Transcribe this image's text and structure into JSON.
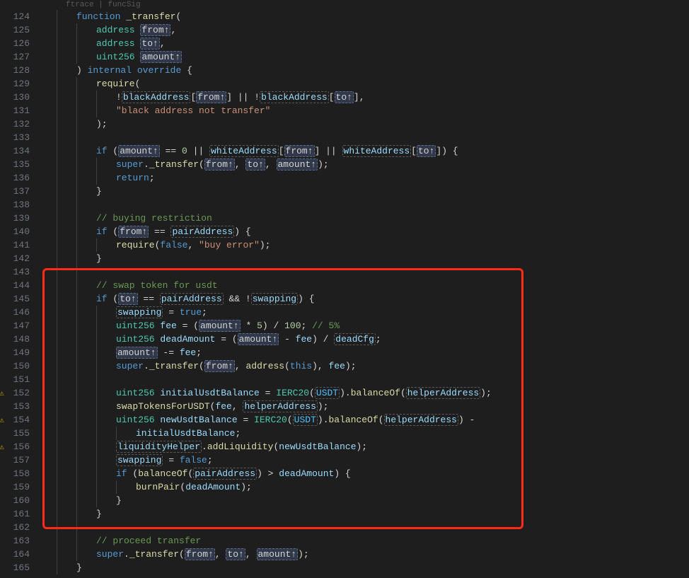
{
  "hint": "ftrace | funcSig",
  "lines": [
    {
      "n": 124,
      "indent": 1,
      "warn": false,
      "tokens": [
        [
          "kw",
          "function"
        ],
        [
          "sp",
          " "
        ],
        [
          "fn",
          "_transfer"
        ],
        [
          "pun",
          "("
        ]
      ]
    },
    {
      "n": 125,
      "indent": 2,
      "warn": false,
      "tokens": [
        [
          "ty",
          "address"
        ],
        [
          "sp",
          " "
        ],
        [
          "hl-param",
          "from↑"
        ],
        [
          "pun",
          ","
        ]
      ]
    },
    {
      "n": 126,
      "indent": 2,
      "warn": false,
      "tokens": [
        [
          "ty",
          "address"
        ],
        [
          "sp",
          " "
        ],
        [
          "hl-param",
          "to↑"
        ],
        [
          "pun",
          ","
        ]
      ]
    },
    {
      "n": 127,
      "indent": 2,
      "warn": false,
      "tokens": [
        [
          "ty",
          "uint256"
        ],
        [
          "sp",
          " "
        ],
        [
          "hl-param",
          "amount↑"
        ]
      ]
    },
    {
      "n": 128,
      "indent": 1,
      "warn": false,
      "tokens": [
        [
          "pun",
          ") "
        ],
        [
          "kw",
          "internal"
        ],
        [
          "sp",
          " "
        ],
        [
          "kw",
          "override"
        ],
        [
          "pun",
          " {"
        ]
      ]
    },
    {
      "n": 129,
      "indent": 2,
      "warn": false,
      "tokens": [
        [
          "fn",
          "require"
        ],
        [
          "pun",
          "("
        ]
      ]
    },
    {
      "n": 130,
      "indent": 3,
      "warn": false,
      "tokens": [
        [
          "op",
          "!"
        ],
        [
          "box var",
          "blackAddress"
        ],
        [
          "pun",
          "["
        ],
        [
          "hl-param",
          "from↑"
        ],
        [
          "pun",
          "] || !"
        ],
        [
          "box var",
          "blackAddress"
        ],
        [
          "pun",
          "["
        ],
        [
          "hl-param",
          "to↑"
        ],
        [
          "pun",
          "],"
        ]
      ]
    },
    {
      "n": 131,
      "indent": 3,
      "warn": false,
      "tokens": [
        [
          "str",
          "\"black address not transfer\""
        ]
      ]
    },
    {
      "n": 132,
      "indent": 2,
      "warn": false,
      "tokens": [
        [
          "pun",
          ");"
        ]
      ]
    },
    {
      "n": 133,
      "indent": 2,
      "warn": false,
      "tokens": []
    },
    {
      "n": 134,
      "indent": 2,
      "warn": false,
      "tokens": [
        [
          "kw",
          "if"
        ],
        [
          "pun",
          " ("
        ],
        [
          "hl-param",
          "amount↑"
        ],
        [
          "op",
          " == "
        ],
        [
          "num",
          "0"
        ],
        [
          "op",
          " || "
        ],
        [
          "box var",
          "whiteAddress"
        ],
        [
          "pun",
          "["
        ],
        [
          "hl-param",
          "from↑"
        ],
        [
          "pun",
          "] || "
        ],
        [
          "box var",
          "whiteAddress"
        ],
        [
          "pun",
          "["
        ],
        [
          "hl-param",
          "to↑"
        ],
        [
          "pun",
          "]) {"
        ]
      ]
    },
    {
      "n": 135,
      "indent": 3,
      "warn": false,
      "tokens": [
        [
          "kw",
          "super"
        ],
        [
          "pun",
          "."
        ],
        [
          "fn",
          "_transfer"
        ],
        [
          "pun",
          "("
        ],
        [
          "hl-param",
          "from↑"
        ],
        [
          "pun",
          ", "
        ],
        [
          "hl-param",
          "to↑"
        ],
        [
          "pun",
          ", "
        ],
        [
          "hl-param",
          "amount↑"
        ],
        [
          "pun",
          ");"
        ]
      ]
    },
    {
      "n": 136,
      "indent": 3,
      "warn": false,
      "tokens": [
        [
          "kw",
          "return"
        ],
        [
          "pun",
          ";"
        ]
      ]
    },
    {
      "n": 137,
      "indent": 2,
      "warn": false,
      "tokens": [
        [
          "pun",
          "}"
        ]
      ]
    },
    {
      "n": 138,
      "indent": 2,
      "warn": false,
      "tokens": []
    },
    {
      "n": 139,
      "indent": 2,
      "warn": false,
      "tokens": [
        [
          "cm",
          "// buying restriction"
        ]
      ]
    },
    {
      "n": 140,
      "indent": 2,
      "warn": false,
      "tokens": [
        [
          "kw",
          "if"
        ],
        [
          "pun",
          " ("
        ],
        [
          "hl-param",
          "from↑"
        ],
        [
          "op",
          " == "
        ],
        [
          "box var",
          "pairAddress"
        ],
        [
          "pun",
          ") {"
        ]
      ]
    },
    {
      "n": 141,
      "indent": 3,
      "warn": false,
      "tokens": [
        [
          "fn",
          "require"
        ],
        [
          "pun",
          "("
        ],
        [
          "kw",
          "false"
        ],
        [
          "pun",
          ", "
        ],
        [
          "str",
          "\"buy error\""
        ],
        [
          "pun",
          ");"
        ]
      ]
    },
    {
      "n": 142,
      "indent": 2,
      "warn": false,
      "tokens": [
        [
          "pun",
          "}"
        ]
      ]
    },
    {
      "n": 143,
      "indent": 2,
      "warn": false,
      "tokens": []
    },
    {
      "n": 144,
      "indent": 2,
      "warn": false,
      "tokens": [
        [
          "cm",
          "// swap token for usdt"
        ]
      ]
    },
    {
      "n": 145,
      "indent": 2,
      "warn": false,
      "tokens": [
        [
          "kw",
          "if"
        ],
        [
          "pun",
          " ("
        ],
        [
          "hl-param",
          "to↑"
        ],
        [
          "op",
          " == "
        ],
        [
          "box var",
          "pairAddress"
        ],
        [
          "op",
          " && !"
        ],
        [
          "box var",
          "swapping"
        ],
        [
          "pun",
          ") {"
        ]
      ]
    },
    {
      "n": 146,
      "indent": 3,
      "warn": false,
      "tokens": [
        [
          "box var",
          "swapping"
        ],
        [
          "op",
          " = "
        ],
        [
          "kw",
          "true"
        ],
        [
          "pun",
          ";"
        ]
      ]
    },
    {
      "n": 147,
      "indent": 3,
      "warn": false,
      "tokens": [
        [
          "ty",
          "uint256"
        ],
        [
          "sp",
          " "
        ],
        [
          "var",
          "fee"
        ],
        [
          "op",
          " = ("
        ],
        [
          "hl-param",
          "amount↑"
        ],
        [
          "op",
          " * "
        ],
        [
          "num",
          "5"
        ],
        [
          "pun",
          ") / "
        ],
        [
          "num",
          "100"
        ],
        [
          "pun",
          "; "
        ],
        [
          "cm",
          "// 5%"
        ]
      ]
    },
    {
      "n": 148,
      "indent": 3,
      "warn": false,
      "tokens": [
        [
          "ty",
          "uint256"
        ],
        [
          "sp",
          " "
        ],
        [
          "var",
          "deadAmount"
        ],
        [
          "op",
          " = ("
        ],
        [
          "hl-param",
          "amount↑"
        ],
        [
          "op",
          " - "
        ],
        [
          "var",
          "fee"
        ],
        [
          "pun",
          ") / "
        ],
        [
          "box var",
          "deadCfg"
        ],
        [
          "pun",
          ";"
        ]
      ]
    },
    {
      "n": 149,
      "indent": 3,
      "warn": false,
      "tokens": [
        [
          "hl-param",
          "amount↑"
        ],
        [
          "op",
          " -= "
        ],
        [
          "var",
          "fee"
        ],
        [
          "pun",
          ";"
        ]
      ]
    },
    {
      "n": 150,
      "indent": 3,
      "warn": false,
      "tokens": [
        [
          "kw",
          "super"
        ],
        [
          "pun",
          "."
        ],
        [
          "fn",
          "_transfer"
        ],
        [
          "pun",
          "("
        ],
        [
          "hl-param",
          "from↑"
        ],
        [
          "pun",
          ", "
        ],
        [
          "fn",
          "address"
        ],
        [
          "pun",
          "("
        ],
        [
          "kw",
          "this"
        ],
        [
          "pun",
          "), "
        ],
        [
          "var",
          "fee"
        ],
        [
          "pun",
          ");"
        ]
      ]
    },
    {
      "n": 151,
      "indent": 3,
      "warn": false,
      "tokens": []
    },
    {
      "n": 152,
      "indent": 3,
      "warn": true,
      "tokens": [
        [
          "ty",
          "uint256"
        ],
        [
          "sp",
          " "
        ],
        [
          "var",
          "initialUsdtBalance"
        ],
        [
          "op",
          " = "
        ],
        [
          "ty",
          "IERC20"
        ],
        [
          "pun",
          "("
        ],
        [
          "box const",
          "USDT"
        ],
        [
          "pun",
          ")."
        ],
        [
          "fn",
          "balanceOf"
        ],
        [
          "pun",
          "("
        ],
        [
          "box var",
          "helperAddress"
        ],
        [
          "pun",
          ");"
        ]
      ]
    },
    {
      "n": 153,
      "indent": 3,
      "warn": false,
      "tokens": [
        [
          "fn",
          "swapTokensForUSDT"
        ],
        [
          "pun",
          "("
        ],
        [
          "var",
          "fee"
        ],
        [
          "pun",
          ", "
        ],
        [
          "box var",
          "helperAddress"
        ],
        [
          "pun",
          ");"
        ]
      ]
    },
    {
      "n": 154,
      "indent": 3,
      "warn": true,
      "tokens": [
        [
          "ty",
          "uint256"
        ],
        [
          "sp",
          " "
        ],
        [
          "var",
          "newUsdtBalance"
        ],
        [
          "op",
          " = "
        ],
        [
          "ty",
          "IERC20"
        ],
        [
          "pun",
          "("
        ],
        [
          "box const",
          "USDT"
        ],
        [
          "pun",
          ")."
        ],
        [
          "fn",
          "balanceOf"
        ],
        [
          "pun",
          "("
        ],
        [
          "box var",
          "helperAddress"
        ],
        [
          "pun",
          ") -"
        ]
      ]
    },
    {
      "n": 155,
      "indent": 4,
      "warn": false,
      "tokens": [
        [
          "var",
          "initialUsdtBalance"
        ],
        [
          "pun",
          ";"
        ]
      ]
    },
    {
      "n": 156,
      "indent": 3,
      "warn": true,
      "tokens": [
        [
          "box var",
          "liquidityHelper"
        ],
        [
          "pun",
          "."
        ],
        [
          "fn",
          "addLiquidity"
        ],
        [
          "pun",
          "("
        ],
        [
          "var",
          "newUsdtBalance"
        ],
        [
          "pun",
          ");"
        ]
      ]
    },
    {
      "n": 157,
      "indent": 3,
      "warn": false,
      "tokens": [
        [
          "box var",
          "swapping"
        ],
        [
          "op",
          " = "
        ],
        [
          "kw",
          "false"
        ],
        [
          "pun",
          ";"
        ]
      ]
    },
    {
      "n": 158,
      "indent": 3,
      "warn": false,
      "tokens": [
        [
          "kw",
          "if"
        ],
        [
          "pun",
          " ("
        ],
        [
          "fn",
          "balanceOf"
        ],
        [
          "pun",
          "("
        ],
        [
          "box var",
          "pairAddress"
        ],
        [
          "pun",
          ") > "
        ],
        [
          "var",
          "deadAmount"
        ],
        [
          "pun",
          ") {"
        ]
      ]
    },
    {
      "n": 159,
      "indent": 4,
      "warn": false,
      "tokens": [
        [
          "fn",
          "burnPair"
        ],
        [
          "pun",
          "("
        ],
        [
          "var",
          "deadAmount"
        ],
        [
          "pun",
          ");"
        ]
      ]
    },
    {
      "n": 160,
      "indent": 3,
      "warn": false,
      "tokens": [
        [
          "pun",
          "}"
        ]
      ]
    },
    {
      "n": 161,
      "indent": 2,
      "warn": false,
      "tokens": [
        [
          "pun",
          "}"
        ]
      ]
    },
    {
      "n": 162,
      "indent": 2,
      "warn": false,
      "tokens": []
    },
    {
      "n": 163,
      "indent": 2,
      "warn": false,
      "tokens": [
        [
          "cm",
          "// proceed transfer"
        ]
      ]
    },
    {
      "n": 164,
      "indent": 2,
      "warn": false,
      "tokens": [
        [
          "kw",
          "super"
        ],
        [
          "pun",
          "."
        ],
        [
          "fn",
          "_transfer"
        ],
        [
          "pun",
          "("
        ],
        [
          "hl-param",
          "from↑"
        ],
        [
          "pun",
          ", "
        ],
        [
          "hl-param",
          "to↑"
        ],
        [
          "pun",
          ", "
        ],
        [
          "hl-param",
          "amount↑"
        ],
        [
          "pun",
          ");"
        ]
      ]
    },
    {
      "n": 165,
      "indent": 1,
      "warn": false,
      "tokens": [
        [
          "pun",
          "}"
        ]
      ]
    }
  ],
  "highlight": {
    "startLine": 143,
    "endLine": 161
  }
}
